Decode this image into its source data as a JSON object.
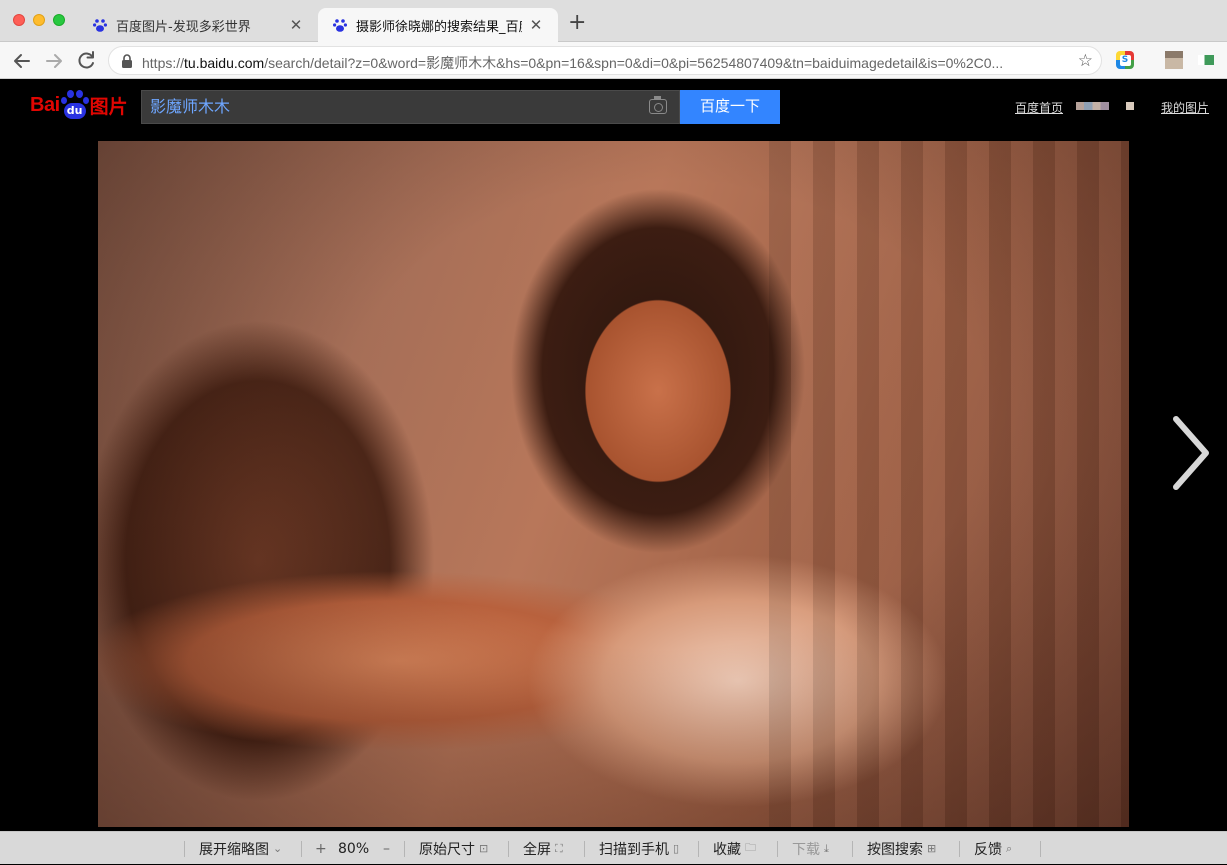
{
  "browser": {
    "tabs": [
      {
        "title": "百度图片-发现多彩世界",
        "active": false
      },
      {
        "title": "摄影师徐晓娜的搜索结果_百度图",
        "active": true
      }
    ],
    "new_tab_label": "+",
    "close_label": "✕",
    "url": {
      "scheme": "https://",
      "host": "tu.baidu.com",
      "rest": "/search/detail?z=0&word=影魔师木木&hs=0&pn=16&spn=0&di=0&pi=56254807409&tn=baiduimagedetail&is=0%2C0..."
    }
  },
  "header": {
    "logo_bai": "Bai",
    "logo_du": "du",
    "logo_tupian": "图片",
    "search_value": "影魔师木木",
    "search_button": "百度一下",
    "link_home": "百度首页",
    "link_mine": "我的图片"
  },
  "viewer": {
    "image_alt": "photo"
  },
  "bottom_toolbar": {
    "expand_thumbs": "展开缩略图",
    "zoom_in": "+",
    "zoom_level": "80%",
    "zoom_out": "–",
    "original_size": "原始尺寸",
    "fullscreen": "全屏",
    "scan_to_phone": "扫描到手机",
    "favorite": "收藏",
    "download": "下载",
    "search_by_image": "按图搜索",
    "feedback": "反馈"
  },
  "colors": {
    "baidu_red": "#e10602",
    "baidu_blue": "#2932e1",
    "search_button_blue": "#3385ff"
  }
}
